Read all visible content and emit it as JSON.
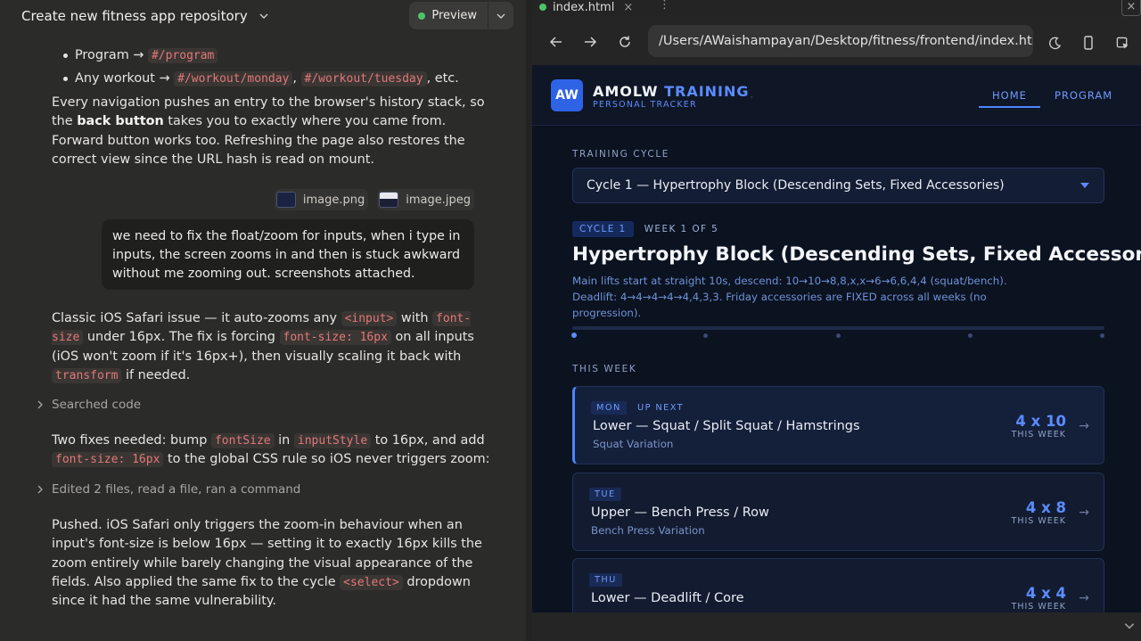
{
  "chat_header": {
    "title": "Create new fitness app repository",
    "preview_label": "Preview"
  },
  "chat": {
    "bullets": [
      {
        "prefix": "Program → ",
        "codes": [
          "#/program"
        ],
        "suffix": ""
      },
      {
        "prefix": "Any workout → ",
        "codes": [
          "#/workout/monday",
          "#/workout/tuesday"
        ],
        "separator": ", ",
        "suffix": ", etc."
      }
    ],
    "para1": {
      "t1": "Every navigation pushes an entry to the browser's history stack, so the ",
      "bold": "back button",
      "t2": " takes you to exactly where you came from. Forward button works too. Refreshing the page also restores the correct view since the URL hash is read on mount."
    },
    "attachments": [
      "image.png",
      "image.jpeg"
    ],
    "user_message": "we need to fix the float/zoom for inputs, when i type in inputs, the screen zooms in and then is stuck awkward without me zooming out. screenshots attached.",
    "para2": {
      "t1": "Classic iOS Safari issue — it auto-zooms any ",
      "c1": "<input>",
      "t2": " with ",
      "c2": "font-size",
      "t3": " under 16px. The fix is forcing ",
      "c3": "font-size: 16px",
      "t4": " on all inputs (iOS won't zoom if it's 16px+), then visually scaling it back with ",
      "c4": "transform",
      "t5": " if needed."
    },
    "collapsed1": "Searched code",
    "para3": {
      "t1": "Two fixes needed: bump ",
      "c1": "fontSize",
      "t2": " in ",
      "c2": "inputStyle",
      "t3": " to 16px, and add ",
      "c3": "font-size: 16px",
      "t4": " to the global CSS rule so iOS never triggers zoom:"
    },
    "collapsed2": "Edited 2 files, read a file, ran a command",
    "para4": {
      "t1": "Pushed. iOS Safari only triggers the zoom-in behaviour when an input's font-size is below 16px — setting it to exactly 16px kills the zoom entirely while barely changing the visual appearance of the fields. Also applied the same fix to the cycle ",
      "c1": "<select>",
      "t2": " dropdown since it had the same vulnerability."
    }
  },
  "browser": {
    "tab_title": "index.html",
    "tab_close": "×",
    "kebab": "⋮",
    "window_close": "×",
    "url": "/Users/AWaishampayan/Desktop/fitness/frontend/index.html"
  },
  "app": {
    "logo": "AW",
    "brand_main": "AMOLW ",
    "brand_accent": "TRAINING",
    "brand_sub": "PERSONAL TRACKER",
    "brand_caret": "˯",
    "nav": {
      "home": "HOME",
      "program": "PROGRAM"
    },
    "cycle_label": "TRAINING CYCLE",
    "cycle_select": "Cycle 1 — Hypertrophy Block (Descending Sets, Fixed Accessories)",
    "badge_cycle": "CYCLE 1",
    "badge_week": "WEEK 1 OF 5",
    "heading": "Hypertrophy Block (Descending Sets, Fixed Accessories)",
    "description": "Main lifts start at straight 10s, descend: 10→10→8,8,x,x→6→6,6,4,4 (squat/bench). Deadlift: 4→4→4→4→4,4,3,3. Friday accessories are FIXED across all weeks (no progression).",
    "progress": {
      "current_week": 1,
      "total_weeks": 5
    },
    "this_week_label": "THIS WEEK",
    "workouts": [
      {
        "day": "MON",
        "up_next": "UP NEXT",
        "name": "Lower — Squat / Split Squat / Hamstrings",
        "variation": "Squat Variation",
        "sets": "4 x 10",
        "sets_label": "THIS WEEK",
        "arrow": "→"
      },
      {
        "day": "TUE",
        "up_next": "",
        "name": "Upper — Bench Press / Row",
        "variation": "Bench Press Variation",
        "sets": "4 x 8",
        "sets_label": "THIS WEEK",
        "arrow": "→"
      },
      {
        "day": "THU",
        "up_next": "",
        "name": "Lower — Deadlift / Core",
        "variation": "",
        "sets": "4 x 4",
        "sets_label": "THIS WEEK",
        "arrow": "→"
      }
    ]
  },
  "colors": {
    "accent": "#5b8cff",
    "bg_app": "#0b1220",
    "bg_chat": "#2b2b2a",
    "code": "#e2787a",
    "status_green": "#4cc36b"
  },
  "icons": [
    "chevron-down-icon",
    "back-arrow-icon",
    "forward-arrow-icon",
    "reload-icon",
    "moon-icon",
    "phone-icon",
    "inspect-icon",
    "chevron-right-icon"
  ]
}
